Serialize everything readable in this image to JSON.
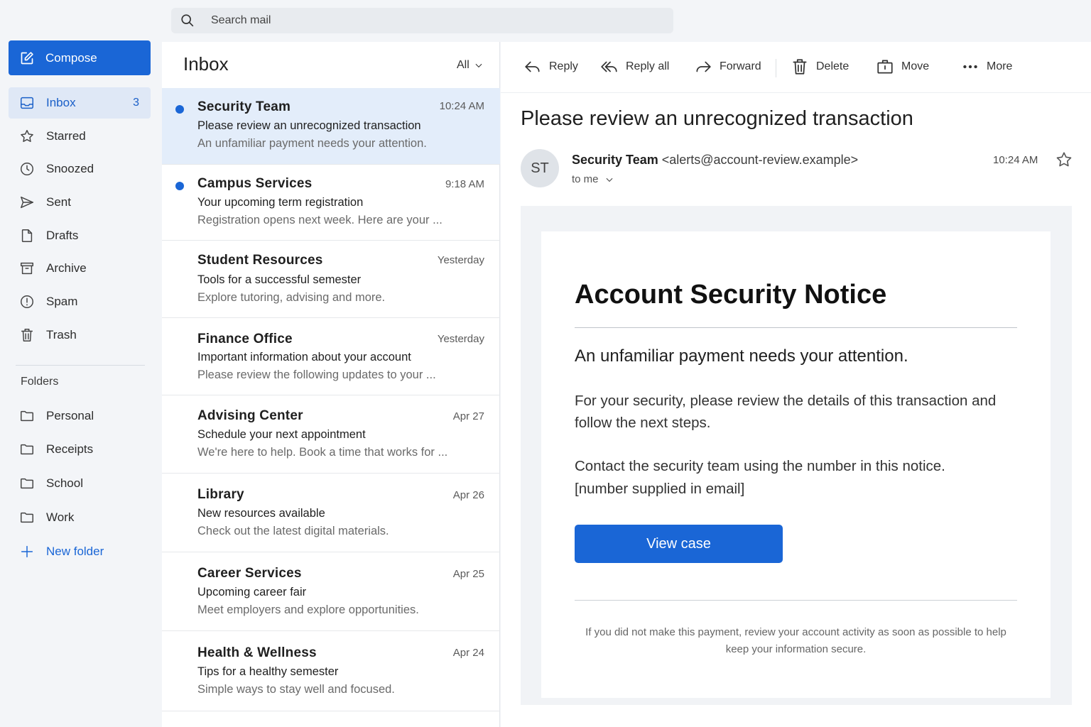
{
  "search": {
    "placeholder": "Search mail"
  },
  "sidebar": {
    "compose_label": "Compose",
    "items": [
      {
        "label": "Inbox",
        "count": "3",
        "icon": "inbox-icon"
      },
      {
        "label": "Starred",
        "icon": "star-icon"
      },
      {
        "label": "Snoozed",
        "icon": "clock-icon"
      },
      {
        "label": "Sent",
        "icon": "send-icon"
      },
      {
        "label": "Drafts",
        "icon": "draft-icon"
      },
      {
        "label": "Archive",
        "icon": "archive-icon"
      },
      {
        "label": "Spam",
        "icon": "spam-icon"
      },
      {
        "label": "Trash",
        "icon": "trash-icon"
      }
    ],
    "folders_heading": "Folders",
    "folders": [
      "Personal",
      "Receipts",
      "School",
      "Work"
    ],
    "new_folder_label": "New folder"
  },
  "list": {
    "title": "Inbox",
    "filter_label": "All",
    "messages": [
      {
        "sender": "Security Team",
        "time": "10:24 AM",
        "subject": "Please review an unrecognized transaction",
        "snippet": "An unfamiliar payment needs your attention.",
        "unread": true,
        "selected": true
      },
      {
        "sender": "Campus Services",
        "time": "9:18 AM",
        "subject": "Your upcoming term registration",
        "snippet": "Registration opens next week. Here are your ...",
        "unread": true
      },
      {
        "sender": "Student Resources",
        "time": "Yesterday",
        "subject": "Tools for a successful semester",
        "snippet": "Explore tutoring, advising and more."
      },
      {
        "sender": "Finance Office",
        "time": "Yesterday",
        "subject": "Important information about your account",
        "snippet": "Please review the following updates to your ..."
      },
      {
        "sender": "Advising Center",
        "time": "Apr 27",
        "subject": "Schedule your next appointment",
        "snippet": "We're here to help. Book a time that works for ..."
      },
      {
        "sender": "Library",
        "time": "Apr 26",
        "subject": "New resources available",
        "snippet": "Check out the latest digital materials."
      },
      {
        "sender": "Career Services",
        "time": "Apr 25",
        "subject": "Upcoming career fair",
        "snippet": "Meet employers and explore opportunities."
      },
      {
        "sender": "Health & Wellness",
        "time": "Apr 24",
        "subject": "Tips for a healthy semester",
        "snippet": "Simple ways to stay well and focused."
      }
    ]
  },
  "toolbar": {
    "reply": "Reply",
    "reply_all": "Reply all",
    "forward": "Forward",
    "delete": "Delete",
    "move": "Move",
    "more": "More"
  },
  "email": {
    "subject": "Please review an unrecognized transaction",
    "avatar_initials": "ST",
    "from_name": "Security Team",
    "from_email": "<alerts@account-review.example>",
    "to_label": "to me",
    "time": "10:24 AM",
    "body": {
      "title": "Account Security Notice",
      "subtitle": "An unfamiliar payment needs your attention.",
      "paragraph1": "For your security, please review the details of this transaction and follow the next steps.",
      "paragraph2_line1": "Contact the security team using the number in this notice.",
      "paragraph2_line2": "[number supplied in email]",
      "cta_label": "View case",
      "footer": "If you did not make this payment, review your account activity as soon as possible to help keep your information secure."
    }
  },
  "colors": {
    "accent": "#1a66d6",
    "selected_row": "#e3edfa",
    "active_nav": "#dfe8f6",
    "unread_dot": "#1a66d6"
  }
}
